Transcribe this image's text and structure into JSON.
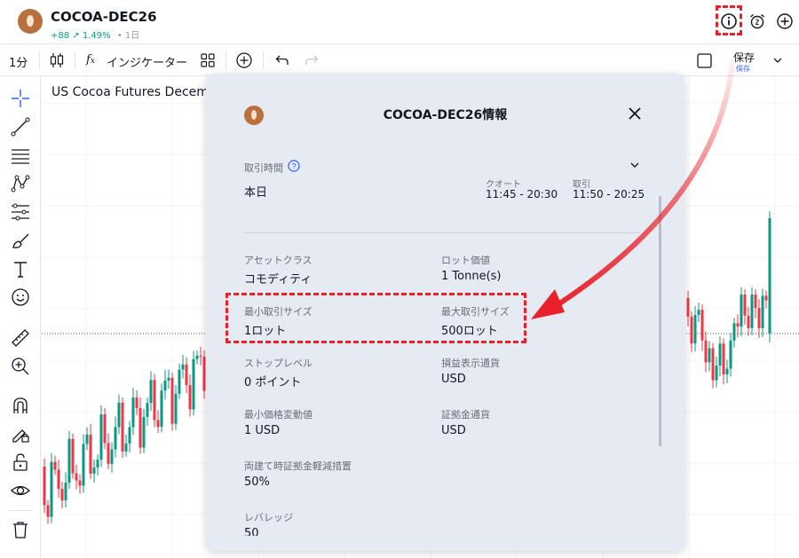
{
  "header": {
    "symbol": "COCOA-DEC26",
    "change_abs": "+88",
    "change_pct": "↗ 1.49%",
    "timeframe": "• 1日"
  },
  "toolbar": {
    "interval": "1分",
    "indicators_label": "インジケーター",
    "save_label": "保存",
    "save_sub": "保存"
  },
  "chart": {
    "title": "US Cocoa Futures Decem"
  },
  "modal": {
    "title": "COCOA-DEC26情報",
    "session": {
      "label": "取引時間",
      "day": "本日",
      "quote_label": "クオート",
      "quote_time": "11:45 - 20:30",
      "trade_label": "取引",
      "trade_time": "11:50 - 20:25"
    },
    "specs": [
      {
        "label": "アセットクラス",
        "value": "コモディティ"
      },
      {
        "label": "ロット価値",
        "value": "1 Tonne(s)"
      },
      {
        "label": "最小取引サイズ",
        "value": "1ロット"
      },
      {
        "label": "最大取引サイズ",
        "value": "500ロット"
      },
      {
        "label": "ストップレベル",
        "value": "0 ポイント"
      },
      {
        "label": "損益表示通貨",
        "value": "USD"
      },
      {
        "label": "最小価格変動値",
        "value": "1 USD"
      },
      {
        "label": "証拠金通貨",
        "value": "USD"
      },
      {
        "label": "両建て時証拠金軽減措置",
        "value": "50%"
      },
      {
        "label": "レバレッジ",
        "value": "50"
      }
    ]
  },
  "colors": {
    "up": "#089981",
    "down": "#f23645",
    "highlight": "#e8212b",
    "accent": "#2962ff"
  }
}
